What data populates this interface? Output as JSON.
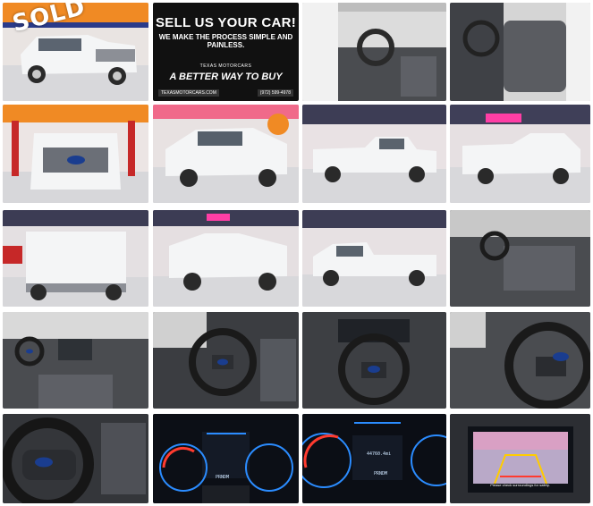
{
  "gallery": {
    "badge_text": "SOLD",
    "promo": {
      "headline": "SELL US YOUR CAR!",
      "subline": "WE MAKE THE PROCESS SIMPLE AND PAINLESS.",
      "brand": "TEXAS MOTORCARS",
      "tagline": "A BETTER WAY TO BUY",
      "site": "TEXASMOTORCARS.COM",
      "phone": "(972) 599-4978"
    },
    "dash": {
      "gear_display": "PRNDM",
      "mileage_text": "44760.4mi"
    },
    "camera_caption": "Please check surroundings for safety.",
    "colors": {
      "truck_white": "#f4f5f6",
      "showroom_floor": "#d9d9dc",
      "interior_gray": "#4a4c50",
      "dash_blue": "#2b8cff",
      "gauge_red": "#ff3b2f",
      "neon_pink": "#ff3ea5",
      "ford_blue": "#1a3d8f"
    },
    "tiles": [
      {
        "row": 1,
        "col": 1,
        "content": "truck front three-quarter with SOLD badge"
      },
      {
        "row": 1,
        "col": 2,
        "content": "promo banner"
      },
      {
        "row": 1,
        "col": 3,
        "content": "driver door interior"
      },
      {
        "row": 1,
        "col": 4,
        "content": "front seats"
      },
      {
        "row": 2,
        "col": 1,
        "content": "front grille"
      },
      {
        "row": 2,
        "col": 2,
        "content": "front three-quarter"
      },
      {
        "row": 2,
        "col": 3,
        "content": "side profile"
      },
      {
        "row": 2,
        "col": 4,
        "content": "rear three-quarter"
      },
      {
        "row": 3,
        "col": 1,
        "content": "tailgate"
      },
      {
        "row": 3,
        "col": 2,
        "content": "rear three-quarter left"
      },
      {
        "row": 3,
        "col": 3,
        "content": "side profile left"
      },
      {
        "row": 3,
        "col": 4,
        "content": "passenger interior"
      },
      {
        "row": 4,
        "col": 1,
        "content": "dashboard center"
      },
      {
        "row": 4,
        "col": 2,
        "content": "steering wheel side"
      },
      {
        "row": 4,
        "col": 3,
        "content": "steering wheel and cluster"
      },
      {
        "row": 4,
        "col": 4,
        "content": "steering wheel close"
      },
      {
        "row": 5,
        "col": 1,
        "content": "steering wheel logo"
      },
      {
        "row": 5,
        "col": 2,
        "content": "gauge cluster"
      },
      {
        "row": 5,
        "col": 3,
        "content": "gauge cluster close"
      },
      {
        "row": 5,
        "col": 4,
        "content": "backup camera screen"
      }
    ]
  }
}
